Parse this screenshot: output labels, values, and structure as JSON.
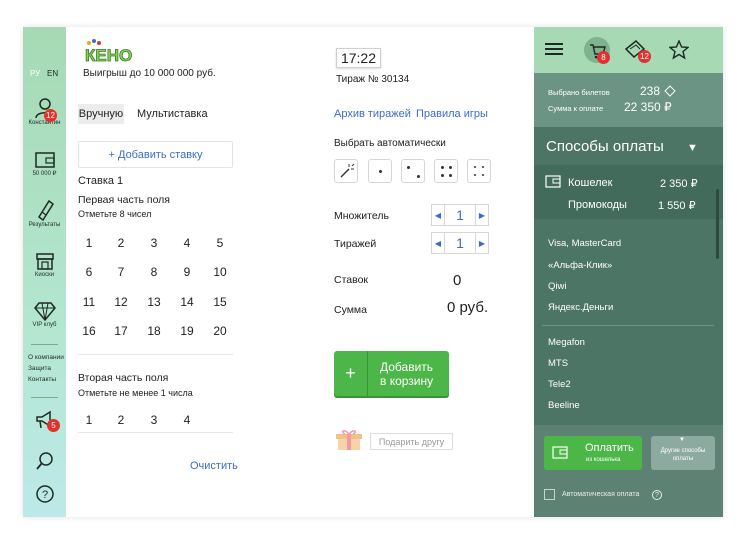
{
  "sidebar": {
    "lang_ru": "РУ",
    "lang_en": "EN",
    "user": {
      "label": "Константин",
      "badge": "12"
    },
    "wallet": {
      "label": "50 000 ₽"
    },
    "results": {
      "label": "Результаты"
    },
    "kiosks": {
      "label": "Киоски"
    },
    "vip": {
      "label": "VIP клуб"
    },
    "links": [
      "О компании",
      "Защита",
      "Контакты"
    ],
    "promo_badge": "5"
  },
  "game": {
    "logo": "КЕНО",
    "prize": "Выигрыш до 10 000 000 руб.",
    "tab_manual": "Вручную",
    "tab_multi": "Мультиставка",
    "add_bet": "+ Добавить ставку",
    "bet_title": "Ставка 1",
    "part1_title": "Первая часть поля",
    "part1_hint": "Отметьте 8 чисел",
    "part1_numbers": [
      "1",
      "2",
      "3",
      "4",
      "5",
      "6",
      "7",
      "8",
      "9",
      "10",
      "11",
      "12",
      "13",
      "14",
      "15",
      "16",
      "17",
      "18",
      "19",
      "20"
    ],
    "part2_title": "Вторая часть поля",
    "part2_hint": "Отметьте не менее 1 числа",
    "part2_numbers": [
      "1",
      "2",
      "3",
      "4"
    ],
    "clear": "Очистить"
  },
  "draw": {
    "time": "17:22",
    "number": "Тираж № 30134",
    "archive_link": "Архив тиражей",
    "rules_link": "Правила игры",
    "auto_title": "Выбрать автоматически",
    "multiplier_label": "Множитель",
    "multiplier_value": "1",
    "draws_label": "Тиражей",
    "draws_value": "1",
    "bets_label": "Ставок",
    "bets_value": "0",
    "sum_label": "Сумма",
    "sum_value": "0 руб.",
    "add_to_cart_line1": "Добавить",
    "add_to_cart_line2": "в корзину",
    "add_plus": "+",
    "gift": "Подарить другу"
  },
  "cart": {
    "cart_badge": "8",
    "tickets_badge": "12",
    "selected_label": "Выбрано билетов",
    "selected_value": "238",
    "total_label": "Сумма к оплате",
    "total_value": "22 350 ₽",
    "payment_title": "Способы оплаты",
    "wallet_label": "Кошелек",
    "wallet_value": "2 350 ₽",
    "promo_label": "Промокоды",
    "promo_value": "1 550 ₽",
    "methods": [
      "Visa, MasterCard",
      "«Альфа-Клик»",
      "Qiwi",
      "Яндекс.Деньги"
    ],
    "mobile": [
      "Megafon",
      "MTS",
      "Tele2",
      "Beeline"
    ],
    "pay_line1": "Оплатить",
    "pay_line2": "из кошелька",
    "other_line1": "Другие способы",
    "other_line2": "оплаты",
    "auto_pay": "Автоматическая оплата"
  },
  "colors": {
    "accent_green": "#4cb748",
    "sidebar_green": "#a6d9b4",
    "panel_dark": "#4d7566",
    "link_blue": "#3a6cc9",
    "badge_red": "#e3312d"
  }
}
